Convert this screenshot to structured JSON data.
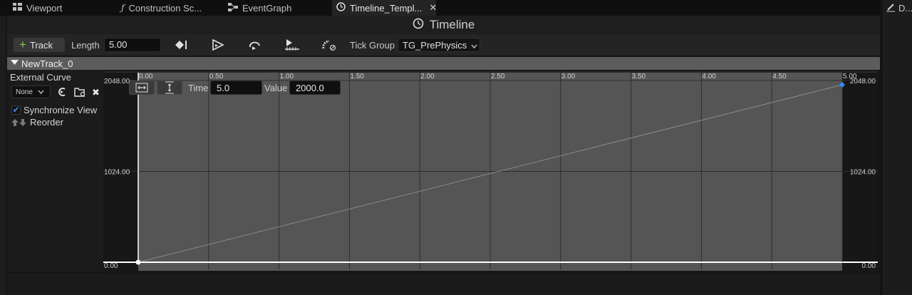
{
  "tabs": [
    {
      "label": "Viewport",
      "icon": "viewport-grid-icon",
      "active": false
    },
    {
      "label": "Construction Sc...",
      "icon": "function-icon",
      "active": false
    },
    {
      "label": "EventGraph",
      "icon": "graph-nodes-icon",
      "active": false
    },
    {
      "label": "Timeline_Templ...",
      "icon": "clock-icon",
      "active": true
    }
  ],
  "right_panel": {
    "label": "D..."
  },
  "title": "Timeline",
  "toolbar": {
    "add_track_label": "Track",
    "length_label": "Length",
    "length_value": "5.00",
    "tick_group_label": "Tick Group",
    "tick_group_value": "TG_PrePhysics",
    "icons": [
      "add-key-icon",
      "autoplay-icon",
      "loop-icon",
      "replicated-icon",
      "ignore-time-dilation-icon"
    ]
  },
  "track": {
    "name": "NewTrack_0",
    "external_curve_label": "External Curve",
    "external_curve_value": "None",
    "synchronize_label": "Synchronize View",
    "synchronize_checked": true,
    "reorder_label": "Reorder"
  },
  "key_editor": {
    "time_label": "Time",
    "time_value": "5.0",
    "value_label": "Value",
    "value_value": "2000.0"
  },
  "chart_data": {
    "type": "line",
    "x_ticks": [
      "0.00",
      "0.50",
      "1.00",
      "1.50",
      "2.00",
      "2.50",
      "3.00",
      "3.50",
      "4.00",
      "4.50",
      "5.00"
    ],
    "y_ticks_left": [
      "2048.00",
      "1024.00",
      "0.00"
    ],
    "y_ticks_right": [
      "2048.00",
      "1024.00",
      "0.00"
    ],
    "xlim": [
      0,
      5
    ],
    "ylim": [
      0,
      2048
    ],
    "series": [
      {
        "points": [
          [
            0,
            0
          ],
          [
            5,
            2000
          ]
        ]
      }
    ],
    "selected_key": [
      5,
      2000
    ],
    "colors": {
      "curve": "#8a8a8a",
      "key": "#ffffff",
      "selected_key": "#2f8fff",
      "range_fill": "#555555"
    }
  }
}
